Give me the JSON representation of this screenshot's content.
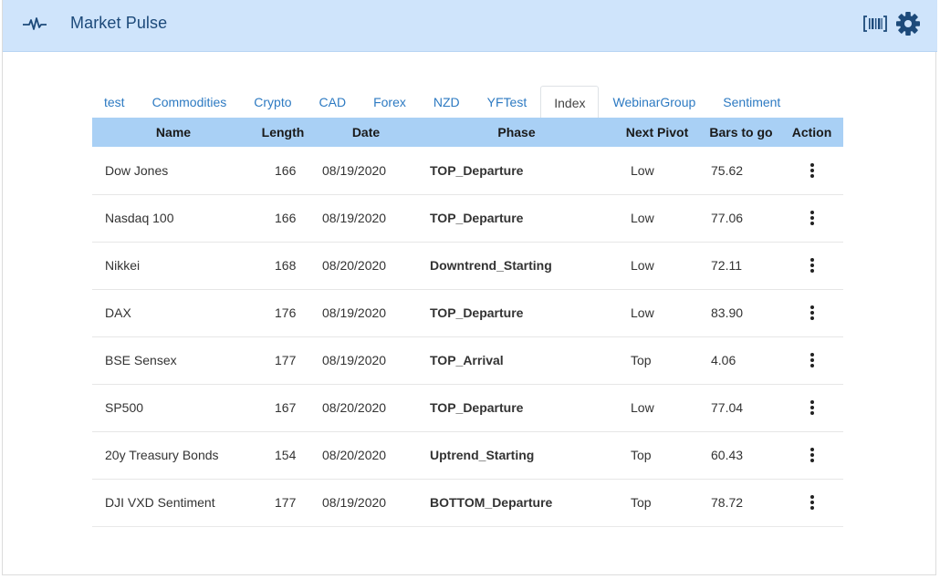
{
  "app": {
    "title": "Market Pulse"
  },
  "icons": {
    "logo": "pulse-icon",
    "barcode": "barcode-icon",
    "settings": "gear-icon",
    "row_action": "kebab-menu-icon"
  },
  "colors": {
    "header_bg": "#cfe4fb",
    "table_header_bg": "#a9d0f5",
    "tab_link": "#2d7ac2"
  },
  "tabs": [
    {
      "label": "test"
    },
    {
      "label": "Commodities"
    },
    {
      "label": "Crypto"
    },
    {
      "label": "CAD"
    },
    {
      "label": "Forex"
    },
    {
      "label": "NZD"
    },
    {
      "label": "YFTest"
    },
    {
      "label": "Index",
      "active": true
    },
    {
      "label": "WebinarGroup"
    },
    {
      "label": "Sentiment"
    }
  ],
  "table": {
    "columns": [
      "Name",
      "Length",
      "Date",
      "Phase",
      "Next Pivot",
      "Bars to go",
      "Action"
    ],
    "rows": [
      {
        "name": "Dow Jones",
        "length": "166",
        "date": "08/19/2020",
        "phase": "TOP_Departure",
        "next_pivot": "Low",
        "bars_to_go": "75.62"
      },
      {
        "name": "Nasdaq 100",
        "length": "166",
        "date": "08/19/2020",
        "phase": "TOP_Departure",
        "next_pivot": "Low",
        "bars_to_go": "77.06"
      },
      {
        "name": "Nikkei",
        "length": "168",
        "date": "08/20/2020",
        "phase": "Downtrend_Starting",
        "next_pivot": "Low",
        "bars_to_go": "72.11"
      },
      {
        "name": "DAX",
        "length": "176",
        "date": "08/19/2020",
        "phase": "TOP_Departure",
        "next_pivot": "Low",
        "bars_to_go": "83.90"
      },
      {
        "name": "BSE Sensex",
        "length": "177",
        "date": "08/19/2020",
        "phase": "TOP_Arrival",
        "next_pivot": "Top",
        "bars_to_go": "4.06"
      },
      {
        "name": "SP500",
        "length": "167",
        "date": "08/20/2020",
        "phase": "TOP_Departure",
        "next_pivot": "Low",
        "bars_to_go": "77.04"
      },
      {
        "name": "20y Treasury Bonds",
        "length": "154",
        "date": "08/20/2020",
        "phase": "Uptrend_Starting",
        "next_pivot": "Top",
        "bars_to_go": "60.43"
      },
      {
        "name": "DJI VXD Sentiment",
        "length": "177",
        "date": "08/19/2020",
        "phase": "BOTTOM_Departure",
        "next_pivot": "Top",
        "bars_to_go": "78.72"
      }
    ]
  }
}
